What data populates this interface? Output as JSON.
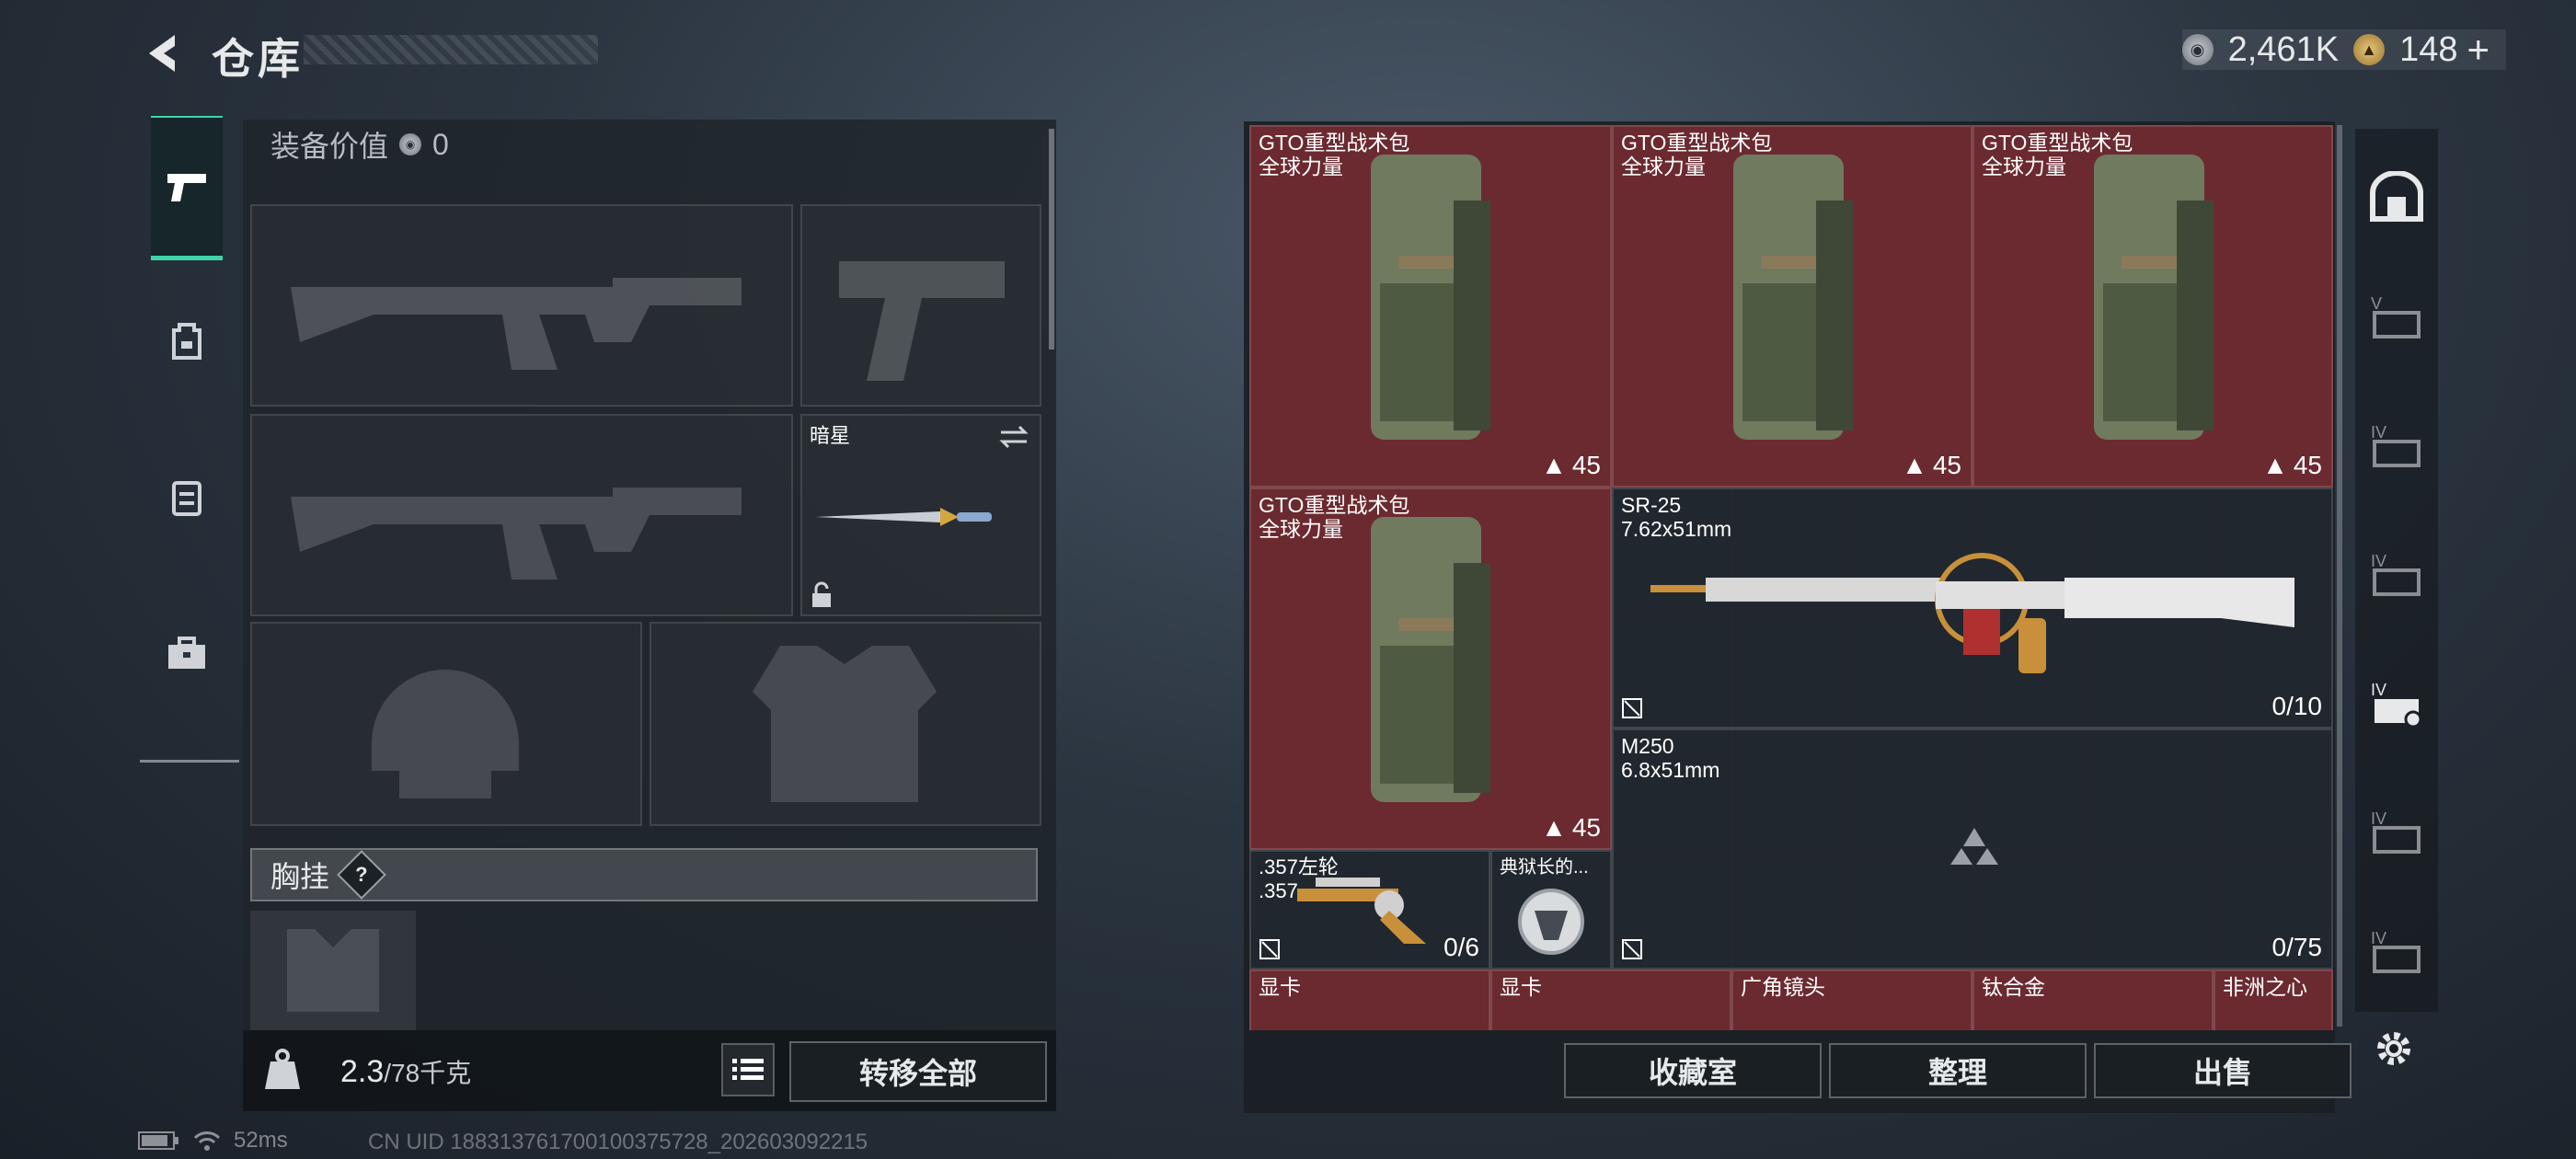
{
  "header": {
    "title": "仓库"
  },
  "currency": [
    {
      "name": "silver-coin",
      "value": "2,461K"
    },
    {
      "name": "gold-coin",
      "value": "148"
    }
  ],
  "plus_label": "+",
  "loadout": {
    "equip_value_label": "装备价值",
    "equip_value": "0",
    "melee_slot": {
      "name": "暗星"
    },
    "chest_label": "胸挂",
    "help": "?",
    "weight_current": "2.3",
    "weight_max": "/78千克",
    "transfer_all": "转移全部"
  },
  "inventory": {
    "items": [
      {
        "name": "GTO重型战术包",
        "sub": "全球力量",
        "count": "45"
      },
      {
        "name": "GTO重型战术包",
        "sub": "全球力量",
        "count": "45"
      },
      {
        "name": "GTO重型战术包",
        "sub": "全球力量",
        "count": "45"
      },
      {
        "name": "GTO重型战术包",
        "sub": "全球力量",
        "count": "45"
      },
      {
        "name": "SR-25",
        "sub": "7.62x51mm",
        "count": "0/10"
      },
      {
        "name": "M250",
        "sub": "6.8x51mm",
        "count": "0/75"
      },
      {
        "name": ".357左轮",
        "sub": ".357",
        "count": "0/6"
      },
      {
        "name": "典狱长的...",
        "sub": "",
        "count": ""
      },
      {
        "name": "显卡",
        "sub": "",
        "count": ""
      },
      {
        "name": "显卡",
        "sub": "",
        "count": ""
      },
      {
        "name": "广角镜头",
        "sub": "",
        "count": ""
      },
      {
        "name": "钛合金",
        "sub": "",
        "count": ""
      },
      {
        "name": "非洲之心",
        "sub": "",
        "count": ""
      }
    ],
    "buttons": {
      "vault": "收藏室",
      "sort": "整理",
      "sell": "出售"
    }
  },
  "right_tabs": [
    "vault",
    "V",
    "IV",
    "IV",
    "IV",
    "IV",
    "IV"
  ],
  "status": {
    "ping": "52ms",
    "uid": "CN UID 188313761700100375728_202603092215"
  },
  "colors": {
    "accent": "#3ed4a8",
    "item_red": "#6b2a30"
  }
}
